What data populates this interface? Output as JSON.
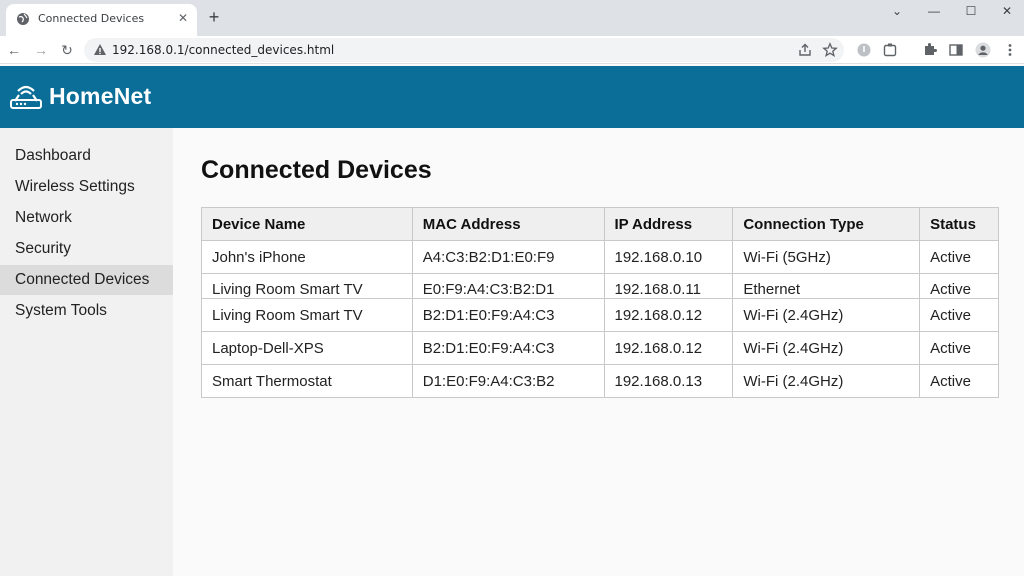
{
  "browser": {
    "tab_title": "Connected Devices",
    "url": "192.168.0.1/connected_devices.html"
  },
  "app": {
    "brand": "HomeNet"
  },
  "sidebar": {
    "items": [
      {
        "label": "Dashboard"
      },
      {
        "label": "Wireless Settings"
      },
      {
        "label": "Network"
      },
      {
        "label": "Security"
      },
      {
        "label": "Connected Devices",
        "active": true
      },
      {
        "label": "System Tools"
      }
    ]
  },
  "main": {
    "title": "Connected Devices",
    "table": {
      "headers": [
        "Device Name",
        "MAC Address",
        "IP Address",
        "Connection Type",
        "Status"
      ],
      "rows": [
        [
          "John's iPhone",
          "A4:C3:B2:D1:E0:F9",
          "192.168.0.10",
          "Wi-Fi (5GHz)",
          "Active"
        ],
        [
          "Living Room Smart TV",
          "E0:F9:A4:C3:B2:D1",
          "192.168.0.11",
          "Ethernet",
          "Active"
        ],
        [
          "Living Room Smart TV",
          "B2:D1:E0:F9:A4:C3",
          "192.168.0.12",
          "Wi-Fi (2.4GHz)",
          "Active"
        ],
        [
          "Laptop-Dell-XPS",
          "B2:D1:E0:F9:A4:C3",
          "192.168.0.12",
          "Wi-Fi (2.4GHz)",
          "Active"
        ],
        [
          "Smart Thermostat",
          "D1:E0:F9:A4:C3:B2",
          "192.168.0.13",
          "Wi-Fi (2.4GHz)",
          "Active"
        ]
      ]
    }
  },
  "colors": {
    "header_bg": "#0a6e98",
    "sidebar_bg": "#f1f1f1",
    "sidebar_active_bg": "#dcdcdc"
  },
  "icons": [
    "globe-icon",
    "close-icon",
    "plus-icon",
    "minimize-icon",
    "maximize-icon",
    "window-close-icon",
    "back-icon",
    "forward-icon",
    "reload-icon",
    "warning-icon",
    "share-icon",
    "star-icon",
    "extension-status-icon",
    "extension-icon",
    "puzzle-icon",
    "sidepanel-icon",
    "profile-icon",
    "menu-icon",
    "router-logo-icon"
  ]
}
